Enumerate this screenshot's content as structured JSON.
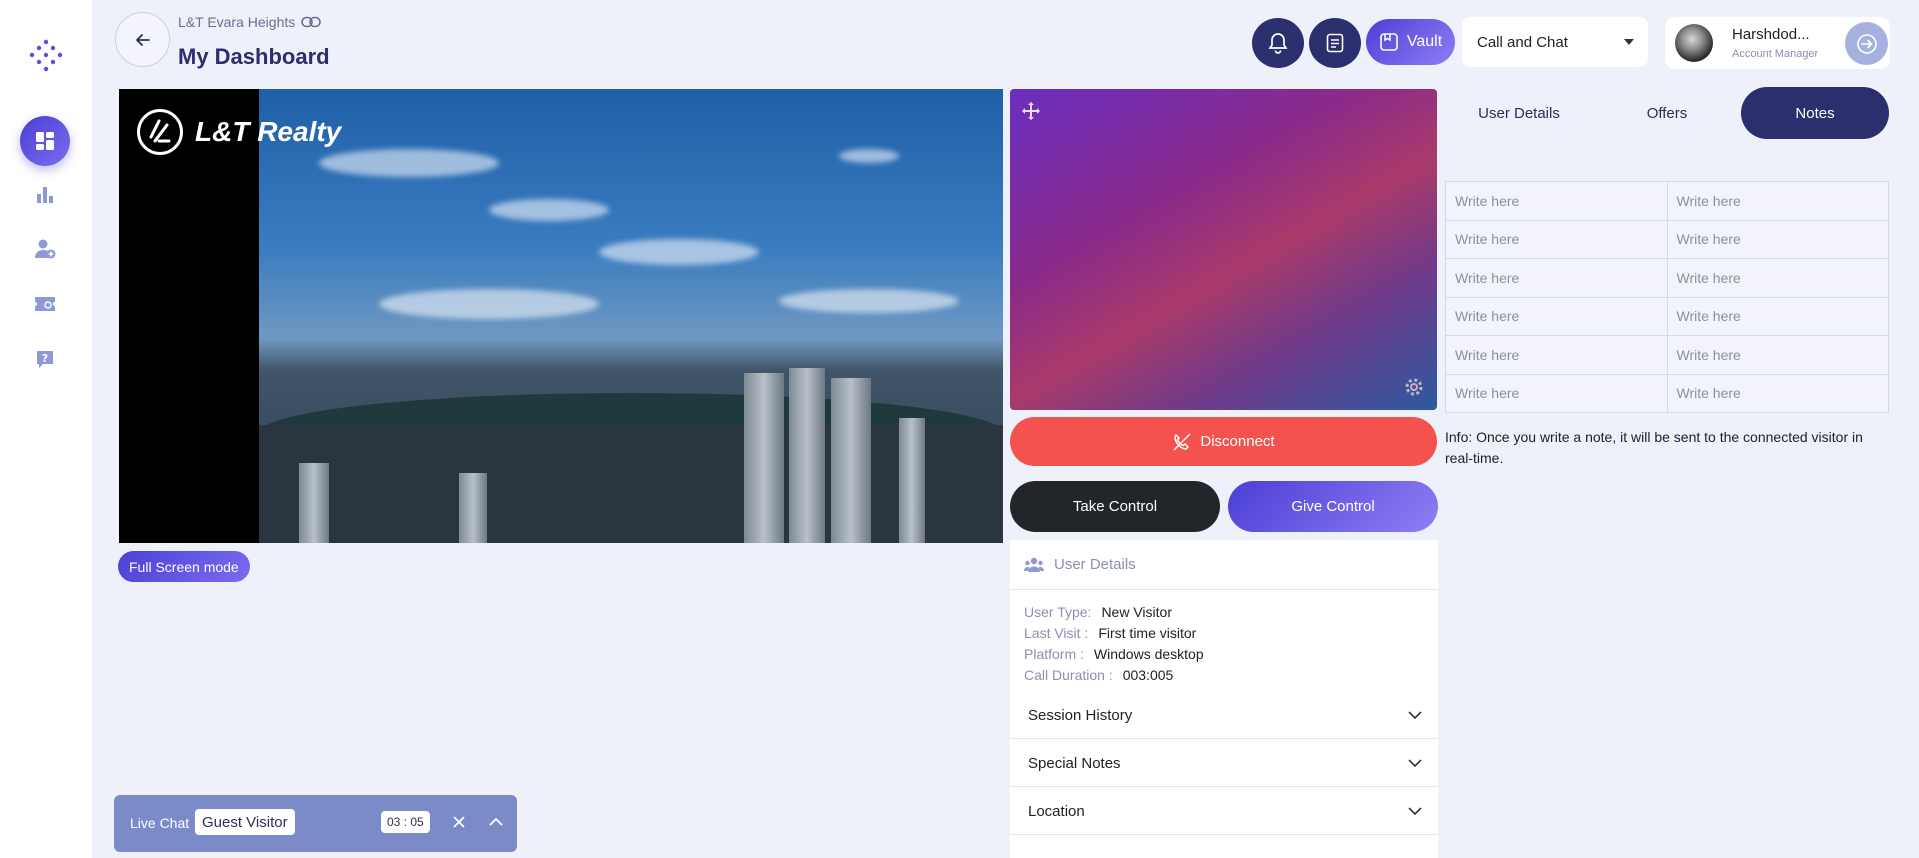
{
  "colors": {
    "accent": "#4b3fd6",
    "navy": "#2b2f6e",
    "danger": "#f4524f",
    "dark": "#22262b",
    "bg": "#eef0fa"
  },
  "sidebar": {
    "items": [
      {
        "icon": "dashboard-icon",
        "active": true
      },
      {
        "icon": "bar-chart-icon",
        "active": false
      },
      {
        "icon": "user-add-icon",
        "active": false
      },
      {
        "icon": "ticket-icon",
        "active": false
      },
      {
        "icon": "help-icon",
        "active": false
      }
    ]
  },
  "header": {
    "project": "L&T Evara Heights",
    "title": "My Dashboard",
    "vault_label": "Vault",
    "mode": "Call and Chat",
    "user_name": "Harshdod...",
    "user_role": "Account Manager"
  },
  "video": {
    "brand": "L&T Realty",
    "fullscreen_label": "Full Screen mode"
  },
  "controls": {
    "disconnect": "Disconnect",
    "take_control": "Take Control",
    "give_control": "Give Control"
  },
  "user_details": {
    "heading": "User Details",
    "rows": [
      {
        "label": "User Type:",
        "value": "New Visitor"
      },
      {
        "label": "Last Visit :",
        "value": "First time visitor"
      },
      {
        "label": "Platform :",
        "value": "Windows desktop"
      },
      {
        "label": "Call Duration :",
        "value": "003:005"
      }
    ],
    "accordions": [
      "Session History",
      "Special Notes",
      "Location"
    ]
  },
  "tabs": [
    {
      "label": "User Details",
      "active": false
    },
    {
      "label": "Offers",
      "active": false
    },
    {
      "label": "Notes",
      "active": true
    }
  ],
  "notes": {
    "placeholder": "Write here",
    "rows": 6,
    "info": "Info: Once you write a note, it will be sent to the connected visitor in real-time."
  },
  "livechat": {
    "label": "Live Chat",
    "guest": "Guest Visitor",
    "timer": "03 : 05"
  }
}
